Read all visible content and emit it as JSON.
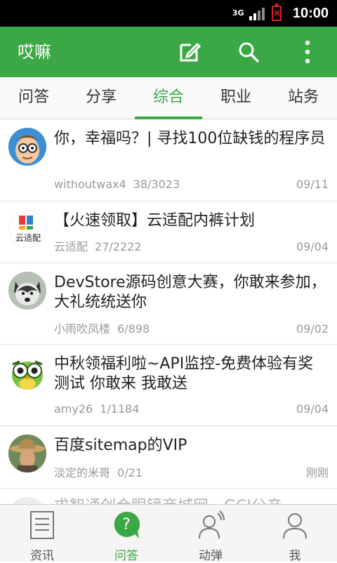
{
  "statusbar": {
    "network": "3G",
    "time": "10:00"
  },
  "appbar": {
    "title": "哎嘛"
  },
  "tabs": [
    {
      "label": "问答"
    },
    {
      "label": "分享"
    },
    {
      "label": "综合",
      "active": true
    },
    {
      "label": "职业"
    },
    {
      "label": "站务"
    }
  ],
  "list": [
    {
      "title": "你，幸福吗？| 寻找100位缺钱的程序员",
      "author": "withoutwax4",
      "count": "38/3023",
      "date": "09/11",
      "avatar": "cartoon-avatar"
    },
    {
      "title": "【火速领取】云适配内裤计划",
      "author": "云适配",
      "count": "27/2222",
      "date": "09/04",
      "avatar": "yunshipei-logo",
      "avatar_text": "云适配"
    },
    {
      "title": "DevStore源码创意大赛，你敢来参加，大礼统统送你",
      "author": "小雨吹凤楼",
      "count": "6/898",
      "date": "09/02",
      "avatar": "husky-avatar"
    },
    {
      "title": "中秋领福利啦~API监控-免费体验有奖测试 你敢来 我敢送",
      "author": "amy26",
      "count": "1/1184",
      "date": "09/04",
      "avatar": "owl-avatar"
    },
    {
      "title": "百度sitemap的VIP",
      "author": "淡定的米哥",
      "count": "0/21",
      "date": "刚刚",
      "avatar": "cowboy-avatar"
    },
    {
      "title": "求智通创合眼镜商城网…GCI公产",
      "author": "",
      "count": "",
      "date": "",
      "avatar": "faded-avatar"
    }
  ],
  "bottomnav": [
    {
      "label": "资讯",
      "icon": "news-icon"
    },
    {
      "label": "问答",
      "icon": "question-icon",
      "active": true
    },
    {
      "label": "动弹",
      "icon": "tweet-person-icon"
    },
    {
      "label": "我",
      "icon": "me-person-icon"
    }
  ],
  "colors": {
    "accent": "#3aa845",
    "statusbar": "#000000",
    "battery_warning": "#e02020"
  }
}
